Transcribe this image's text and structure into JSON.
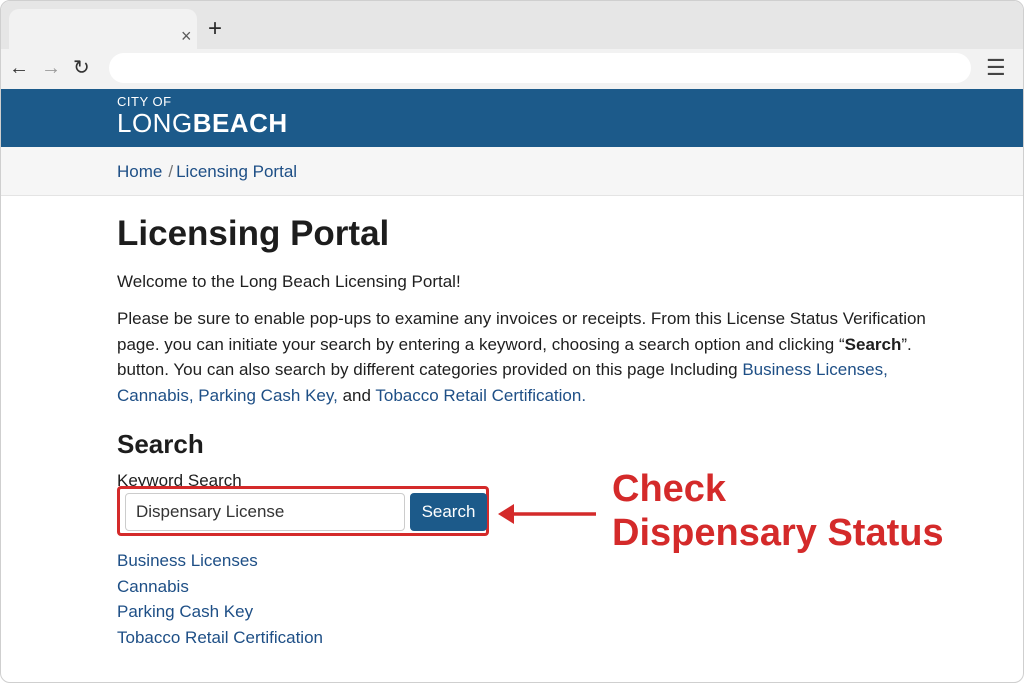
{
  "browser": {
    "tab_close": "×",
    "new_tab": "+",
    "back": "←",
    "forward": "→",
    "reload": "↻",
    "menu": "☰",
    "address_value": ""
  },
  "header": {
    "logo_small": "CITY OF",
    "logo_long": "LONG",
    "logo_beach": "BEACH",
    "color": "#1c5a8a"
  },
  "breadcrumb": {
    "home": "Home",
    "separator": "/",
    "current": "Licensing Portal"
  },
  "main": {
    "title": "Licensing Portal",
    "welcome": "Welcome to the Long Beach Licensing Portal!",
    "para_1": "Please be sure to enable pop-ups to examine any invoices or receipts. From this License Status Verification page. you can initiate your search by entering a keyword, choosing a search option and clicking “",
    "para_bold": "Search",
    "para_2": "”. button. You can also search by different categories provided on this page Including ",
    "inline_links": [
      "Business Licenses,",
      "Cannabis,",
      "Parking Cash Key,",
      "Tobacco Retail Certification."
    ],
    "para_and": "and",
    "search_heading": "Search",
    "keyword_label": "Keyword Search",
    "keyword_value": "Dispensary License",
    "search_button": "Search",
    "category_links": [
      "Business Licenses",
      "Cannabis",
      "Parking Cash Key",
      "Tobacco Retail Certification"
    ]
  },
  "annotation": {
    "line1": "Check",
    "line2": "Dispensary Status",
    "color": "#d42a2a"
  }
}
